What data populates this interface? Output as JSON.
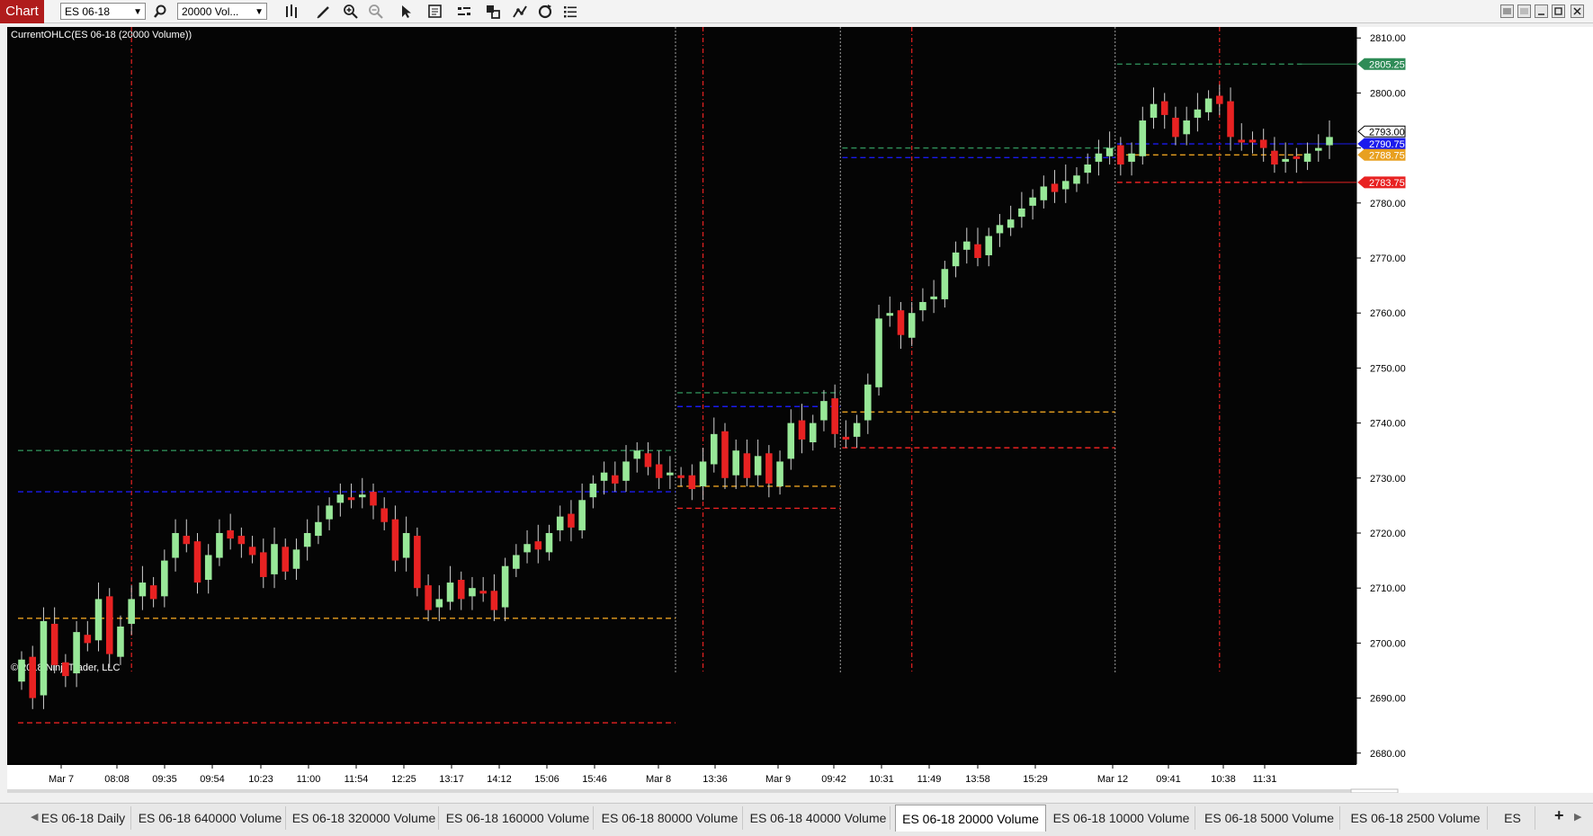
{
  "toolbar": {
    "chart_label": "Chart",
    "instrument": "ES 06-18",
    "period": "20000 Vol..."
  },
  "chart": {
    "indicator_label": "CurrentOHLC(ES 06-18 (20000 Volume))",
    "copyright": "© 2018 NinjaTrader, LLC",
    "colors": {
      "background": "#050505",
      "up": "#98e898",
      "down": "#e82222",
      "high_line": "#2e8b57",
      "mid_line": "#1a1aee",
      "low_line": "#e8a020",
      "red_line": "#e82222",
      "session_sep": "#9e9e9e"
    }
  },
  "chart_data": {
    "type": "candlestick",
    "y_range": [
      2678,
      2812
    ],
    "y_ticks": [
      "2810.00",
      "2800.00",
      "2790.00",
      "2780.00",
      "2770.00",
      "2760.00",
      "2750.00",
      "2740.00",
      "2730.00",
      "2720.00",
      "2710.00",
      "2700.00",
      "2690.00",
      "2680.00"
    ],
    "x_labels": [
      "Mar 7",
      "08:08",
      "09:35",
      "09:54",
      "10:23",
      "11:00",
      "11:54",
      "12:25",
      "13:17",
      "14:12",
      "15:06",
      "15:46",
      "Mar 8",
      "13:36",
      "Mar 9",
      "09:42",
      "10:31",
      "11:49",
      "13:58",
      "15:29",
      "Mar 12",
      "09:41",
      "10:38",
      "11:31"
    ],
    "price_flags": [
      {
        "label": "2805.25",
        "value": 2805.25,
        "color": "#2e8b57"
      },
      {
        "label": "2793.00",
        "value": 2793.0,
        "color": "#ffffff"
      },
      {
        "label": "2790.75",
        "value": 2790.75,
        "color": "#1a1aee"
      },
      {
        "label": "2788.75",
        "value": 2788.75,
        "color": "#e8a020"
      },
      {
        "label": "2783.75",
        "value": 2783.75,
        "color": "#e82222"
      }
    ],
    "sessions": [
      {
        "name": "Mar 7",
        "high": 2735,
        "mid": 2727.5,
        "low_mark": 2704.5,
        "low": 2685.5
      },
      {
        "name": "Mar 8",
        "high": 2745.5,
        "mid": 2743,
        "low_mark": 2728.5,
        "low": 2724.5
      },
      {
        "name": "Mar 9",
        "high": 2790,
        "mid": 2788.25,
        "low_mark": 2742,
        "low": 2735.5
      },
      {
        "name": "Mar 12",
        "high": 2805.25,
        "mid": 2790.75,
        "low_mark": 2788.75,
        "low": 2783.75
      }
    ],
    "closes": [
      2697,
      2690,
      2704,
      2696,
      2694,
      2702,
      2700,
      2708,
      2698,
      2703,
      2708,
      2711,
      2708,
      2715,
      2720,
      2718,
      2711,
      2716,
      2720,
      2719,
      2718,
      2716,
      2712,
      2718,
      2713,
      2717,
      2720,
      2722,
      2725,
      2727,
      2726,
      2727,
      2725,
      2722,
      2715,
      2720,
      2710,
      2706,
      2708,
      2711,
      2708,
      2710,
      2709,
      2706,
      2714,
      2716,
      2718,
      2717,
      2720,
      2723,
      2721,
      2726,
      2729,
      2731,
      2729,
      2733,
      2735,
      2732,
      2730,
      2731,
      2730,
      2728,
      2733,
      2738,
      2730,
      2735,
      2730,
      2734,
      2729,
      2733,
      2740,
      2737,
      2740,
      2744,
      2738,
      2737,
      2740,
      2747,
      2759,
      2760,
      2756,
      2760,
      2762,
      2763,
      2768,
      2771,
      2773,
      2770,
      2774,
      2776,
      2777,
      2779,
      2781,
      2783,
      2782,
      2784,
      2785,
      2787,
      2789,
      2790,
      2787,
      2789,
      2795,
      2798,
      2796,
      2792,
      2795,
      2797,
      2799,
      2798,
      2792,
      2791,
      2791,
      2790,
      2787,
      2788,
      2788,
      2789,
      2790,
      2792
    ]
  },
  "tabs": [
    {
      "label": "ES 06-18 Daily"
    },
    {
      "label": "ES 06-18 640000 Volume"
    },
    {
      "label": "ES 06-18 320000 Volume"
    },
    {
      "label": "ES 06-18 160000 Volume"
    },
    {
      "label": "ES 06-18 80000 Volume"
    },
    {
      "label": "ES 06-18 40000 Volume"
    },
    {
      "label": "ES 06-18 20000 Volume"
    },
    {
      "label": "ES 06-18 10000 Volume"
    },
    {
      "label": "ES 06-18 5000 Volume"
    },
    {
      "label": "ES 06-18 2500 Volume"
    },
    {
      "label": "ES"
    }
  ]
}
